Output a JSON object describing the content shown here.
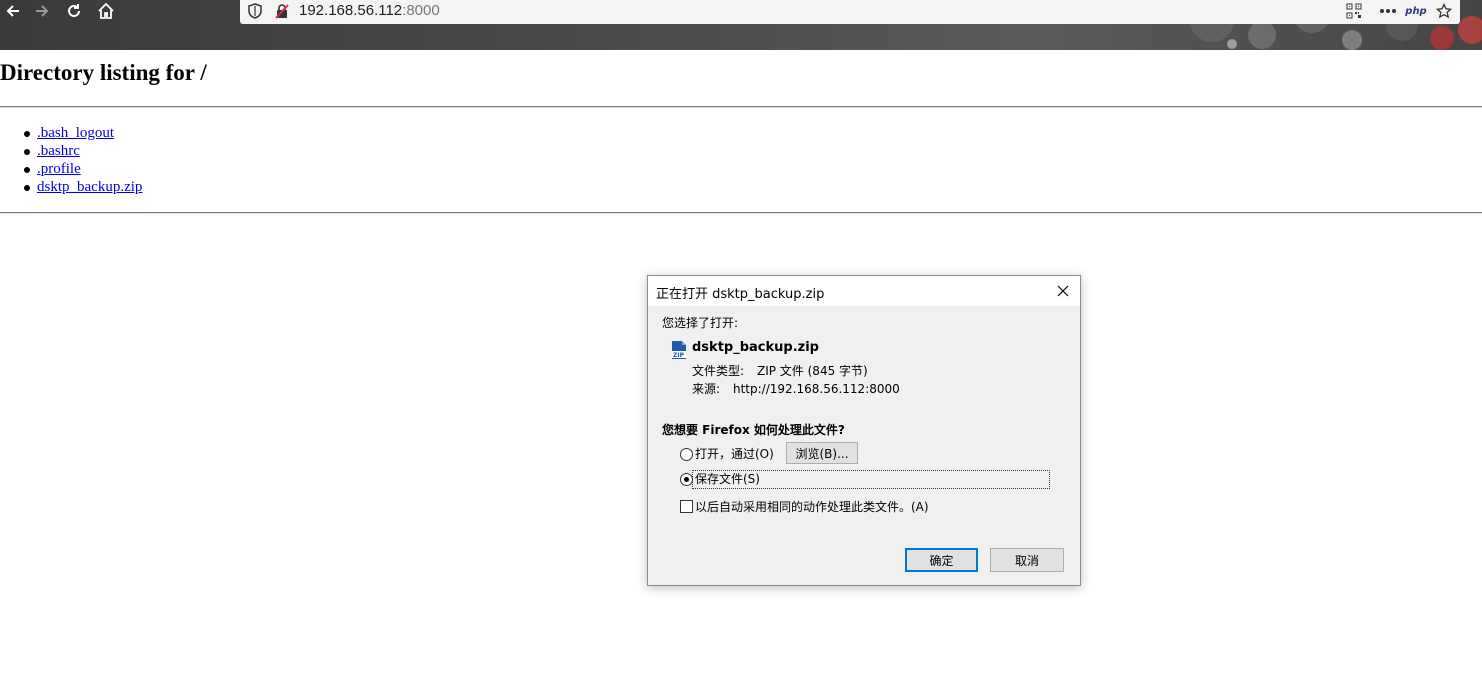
{
  "browser": {
    "url_host": "192.168.56.112",
    "url_port": ":8000",
    "page_action": "php"
  },
  "page": {
    "title": "Directory listing for /",
    "files": [
      ".bash_logout",
      ".bashrc",
      ".profile",
      "dsktp_backup.zip"
    ]
  },
  "dialog": {
    "title": "正在打开 dsktp_backup.zip",
    "chosen_label": "您选择了打开:",
    "file_name": "dsktp_backup.zip",
    "file_type_label": "文件类型:",
    "file_type_value": "ZIP 文件 (845 字节)",
    "source_label": "来源:",
    "source_value": "http://192.168.56.112:8000",
    "question": "您想要 Firefox 如何处理此文件?",
    "open_with_label": "打开，通过(O)",
    "browse_button": "浏览(B)...",
    "save_file_label": "保存文件(S)",
    "auto_label": "以后自动采用相同的动作处理此类文件。(A)",
    "ok_button": "确定",
    "cancel_button": "取消",
    "selected_option": "save_file",
    "auto_checked": false
  }
}
